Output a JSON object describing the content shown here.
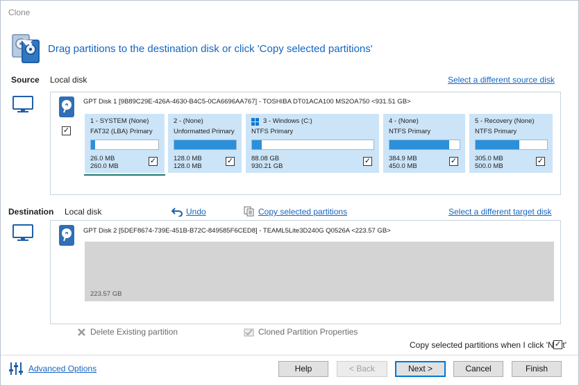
{
  "window": {
    "title": "Clone"
  },
  "header": {
    "heading": "Drag partitions to the destination disk or click 'Copy selected partitions'"
  },
  "source": {
    "label": "Source",
    "disk_type": "Local disk",
    "select_link": "Select a different source disk",
    "disk_info": "GPT Disk 1 [9B89C29E-426A-4630-B4C5-0CA6696AA767] - TOSHIBA DT01ACA100 MS2OA750  <931.51 GB>",
    "select_all_checked": true,
    "partitions": [
      {
        "name": "1 - SYSTEM (None)",
        "type": "FAT32 (LBA) Primary",
        "used": "26.0 MB",
        "total": "260.0 MB",
        "fill": 0.06,
        "checked": true,
        "windows_logo": false
      },
      {
        "name": "2 -  (None)",
        "type": "Unformatted Primary",
        "used": "128.0 MB",
        "total": "128.0 MB",
        "fill": 1.0,
        "checked": true,
        "windows_logo": false
      },
      {
        "name": "3 - Windows (C:)",
        "type": "NTFS Primary",
        "used": "88.08 GB",
        "total": "930.21 GB",
        "fill": 0.08,
        "checked": true,
        "windows_logo": true
      },
      {
        "name": "4 -  (None)",
        "type": "NTFS Primary",
        "used": "384.9 MB",
        "total": "450.0 MB",
        "fill": 0.85,
        "checked": true,
        "windows_logo": false
      },
      {
        "name": "5 - Recovery (None)",
        "type": "NTFS Primary",
        "used": "305.0 MB",
        "total": "500.0 MB",
        "fill": 0.61,
        "checked": true,
        "windows_logo": false
      }
    ]
  },
  "destination": {
    "label": "Destination",
    "disk_type": "Local disk",
    "undo": "Undo",
    "copy_selected": "Copy selected partitions",
    "select_link": "Select a different target disk",
    "disk_info": "GPT Disk 2 [5DEF8674-739E-451B-B72C-849585F6CED8] - TEAML5Lite3D240G Q0526A  <223.57 GB>",
    "free_space": "223.57 GB"
  },
  "actions": {
    "delete_partition": "Delete Existing partition",
    "cloned_properties": "Cloned Partition Properties",
    "copy_on_next": "Copy selected partitions when I click 'Next'",
    "copy_on_next_checked": true
  },
  "footer": {
    "advanced_options": "Advanced Options",
    "help": "Help",
    "back": "< Back",
    "next": "Next >",
    "cancel": "Cancel",
    "finish": "Finish"
  },
  "colors": {
    "accent": "#1565c0",
    "partition_bg": "#cce4f7",
    "bar_fill": "#2b90d9",
    "unallocated": "#d4d4d4"
  }
}
